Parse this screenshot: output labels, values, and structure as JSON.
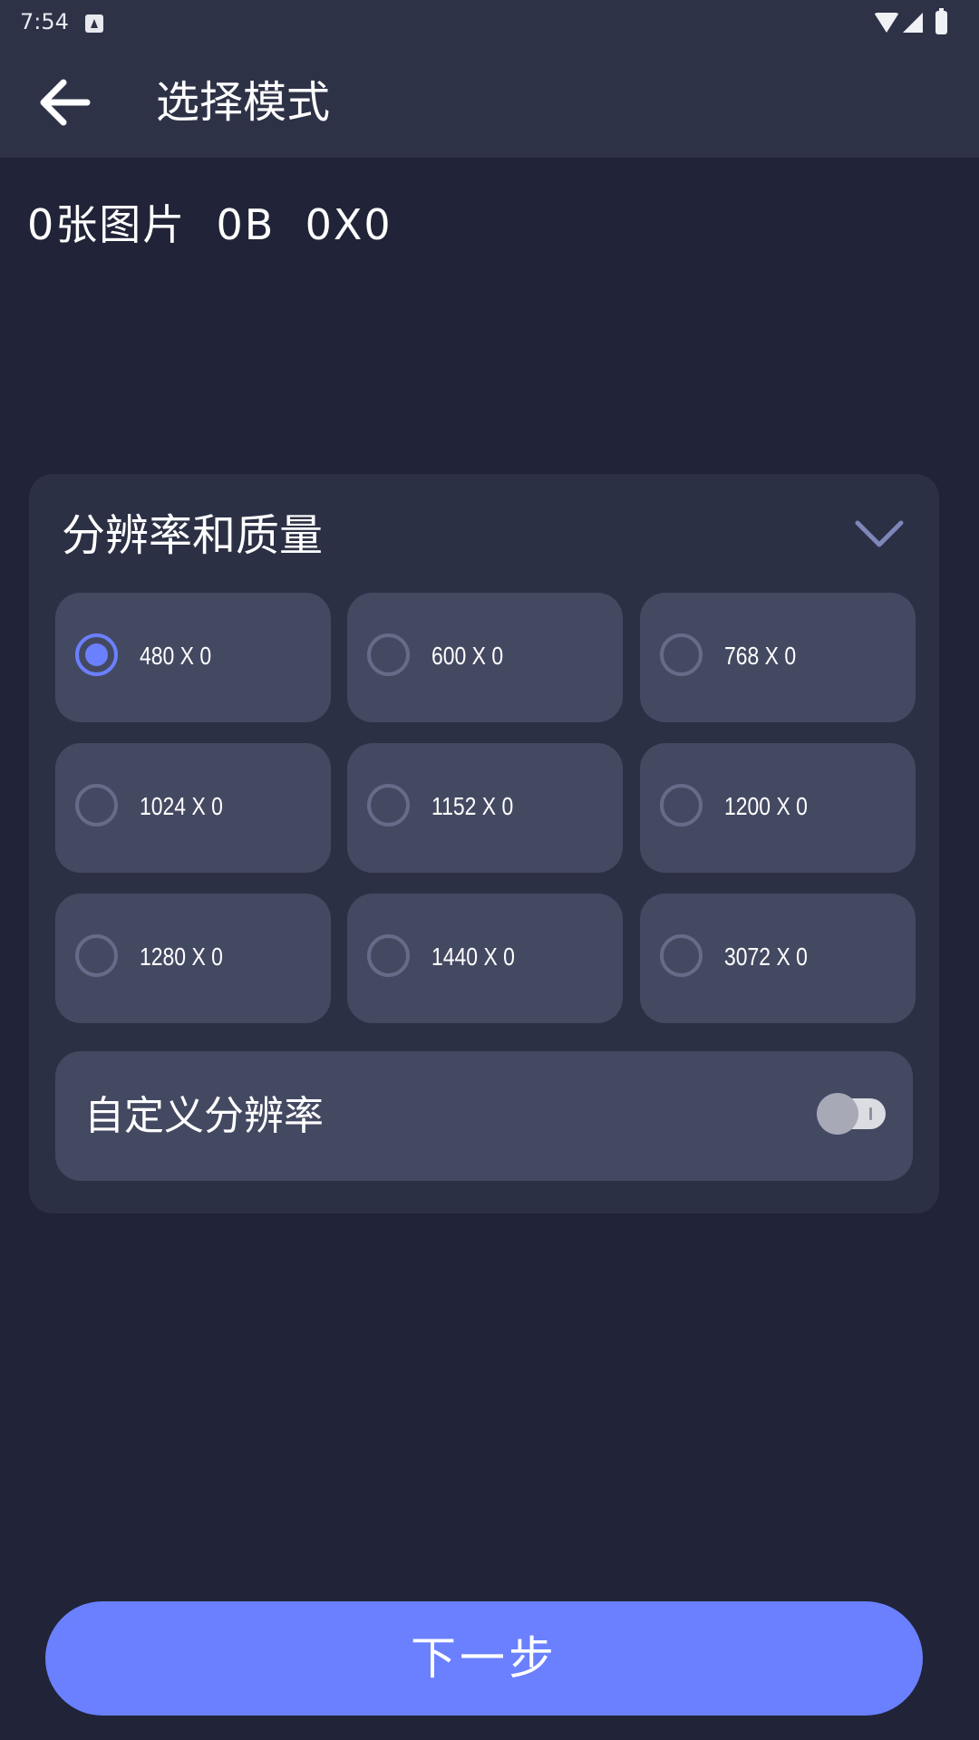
{
  "status_bar": {
    "time": "7:54",
    "icons": [
      "notification-a-icon",
      "wifi-icon",
      "cell-signal-icon",
      "battery-icon"
    ]
  },
  "app_bar": {
    "title": "选择模式",
    "back_icon": "arrow-left-icon"
  },
  "info": {
    "text": "0张图片  0B  0X0"
  },
  "resolution_card": {
    "title": "分辨率和质量",
    "collapse_icon": "chevron-down-icon",
    "options": [
      {
        "label": "480 X 0",
        "selected": true
      },
      {
        "label": "600 X 0",
        "selected": false
      },
      {
        "label": "768 X 0",
        "selected": false
      },
      {
        "label": "1024 X 0",
        "selected": false
      },
      {
        "label": "1152 X 0",
        "selected": false
      },
      {
        "label": "1200 X 0",
        "selected": false
      },
      {
        "label": "1280 X 0",
        "selected": false
      },
      {
        "label": "1440 X 0",
        "selected": false
      },
      {
        "label": "3072 X 0",
        "selected": false
      }
    ],
    "custom": {
      "label": "自定义分辨率",
      "enabled": false
    }
  },
  "footer": {
    "next_label": "下一步"
  },
  "colors": {
    "background": "#212438",
    "header": "#2e3247",
    "card": "#2c3045",
    "option": "#444962",
    "accent": "#6a80ff"
  }
}
